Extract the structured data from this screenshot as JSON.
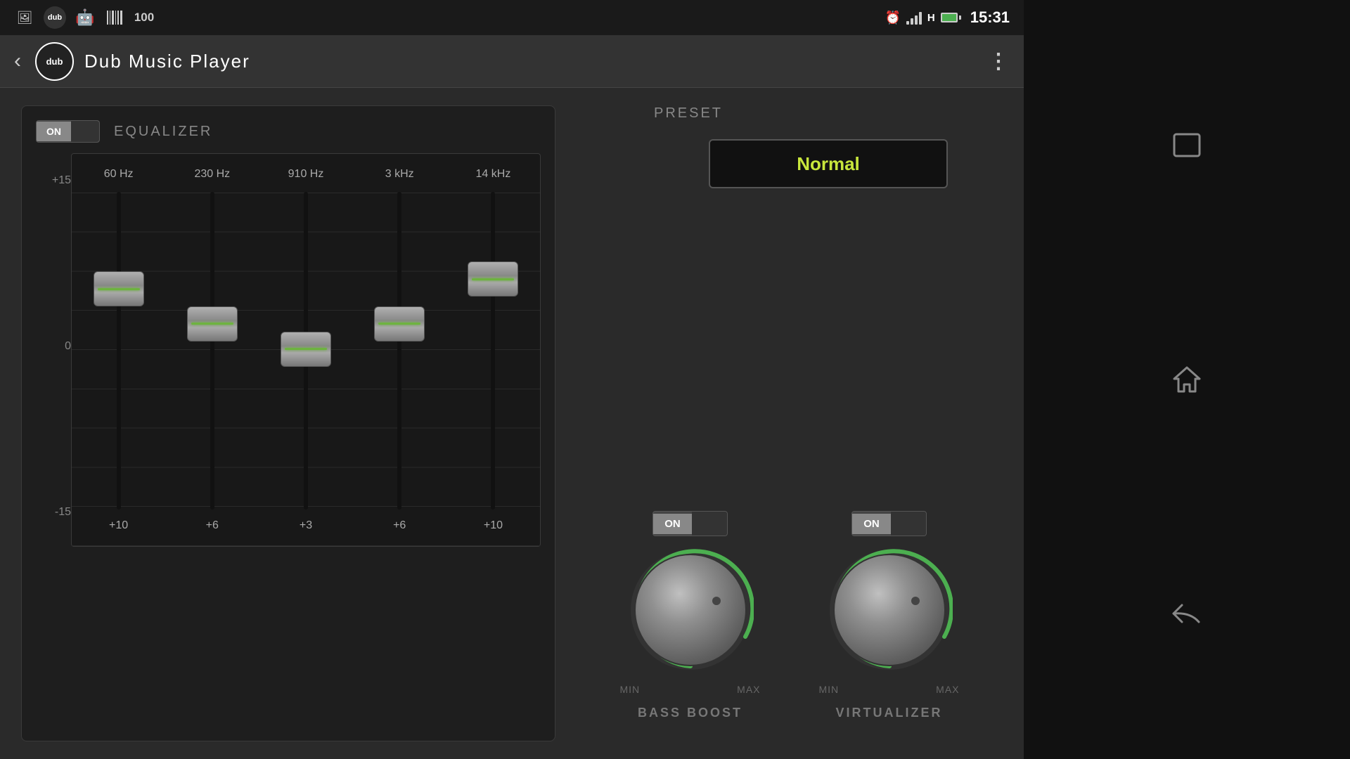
{
  "status_bar": {
    "time": "15:31",
    "icons": [
      "photo",
      "dub",
      "android",
      "barcode",
      "100"
    ]
  },
  "title_bar": {
    "app_name": "Dub  Music  Player",
    "logo_text": "dub",
    "back_label": "‹",
    "menu_label": "⋮"
  },
  "equalizer": {
    "title": "EQUALIZER",
    "toggle_on": "ON",
    "bands": [
      {
        "freq": "60 Hz",
        "value": "+10",
        "position": 25
      },
      {
        "freq": "230 Hz",
        "value": "+6",
        "position": 38
      },
      {
        "freq": "910 Hz",
        "value": "+3",
        "position": 48
      },
      {
        "freq": "3 kHz",
        "value": "+6",
        "position": 38
      },
      {
        "freq": "14 kHz",
        "value": "+10",
        "position": 22
      }
    ],
    "scale": {
      "top": "+15",
      "mid": "0",
      "bottom": "-15"
    }
  },
  "preset": {
    "label": "PRESET",
    "value": "Normal"
  },
  "bass_boost": {
    "label": "BASS BOOST",
    "toggle_on": "ON",
    "min_label": "MIN",
    "max_label": "MAX"
  },
  "virtualizer": {
    "label": "VIRTUALIZER",
    "toggle_on": "ON",
    "min_label": "MIN",
    "max_label": "MAX"
  },
  "android_nav": {
    "window_icon": "▭",
    "home_icon": "⌂",
    "back_icon": "↩"
  }
}
